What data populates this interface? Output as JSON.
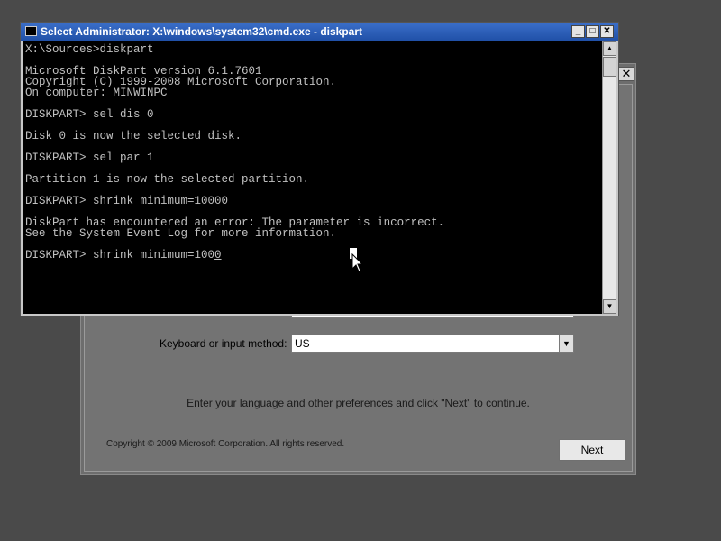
{
  "setup": {
    "close_glyph": "✕",
    "keyboard_label": "Keyboard or input method:",
    "keyboard_value": "US",
    "instructions": "Enter your language and other preferences and click \"Next\" to continue.",
    "copyright": "Copyright © 2009 Microsoft Corporation. All rights reserved.",
    "next_label": "Next"
  },
  "cmd": {
    "title": "Select Administrator: X:\\windows\\system32\\cmd.exe - diskpart",
    "lines": [
      "X:\\Sources>diskpart",
      "",
      "Microsoft DiskPart version 6.1.7601",
      "Copyright (C) 1999-2008 Microsoft Corporation.",
      "On computer: MINWINPC",
      "",
      "DISKPART> sel dis 0",
      "",
      "Disk 0 is now the selected disk.",
      "",
      "DISKPART> sel par 1",
      "",
      "Partition 1 is now the selected partition.",
      "",
      "DISKPART> shrink minimum=10000",
      "",
      "DiskPart has encountered an error: The parameter is incorrect.",
      "See the System Event Log for more information.",
      ""
    ],
    "current_command": "DISKPART> shrink minimum=100",
    "current_command_last": "0",
    "icons": {
      "window": "console-icon",
      "minimize": "minimize-icon",
      "maximize": "maximize-icon",
      "close": "close-icon",
      "scroll_up": "scroll-up-arrow-icon",
      "scroll_down": "scroll-down-arrow-icon",
      "pointer": "mouse-pointer-icon"
    }
  },
  "colors": {
    "desktop": "#4a4a4a",
    "titlebar": "#2b5cb8",
    "console_bg": "#000000",
    "console_text": "#c0c0c0"
  }
}
